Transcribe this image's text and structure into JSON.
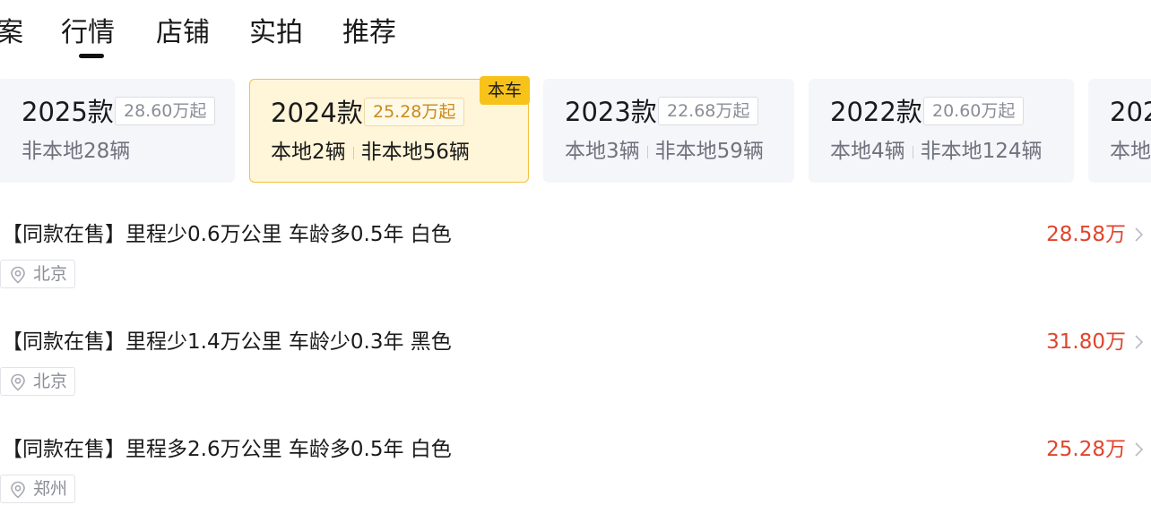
{
  "tabs": [
    {
      "label": "案"
    },
    {
      "label": "行情"
    },
    {
      "label": "店铺"
    },
    {
      "label": "实拍"
    },
    {
      "label": "推荐"
    }
  ],
  "active_tab": "行情",
  "year_cards": [
    {
      "year": "2025款",
      "price": "28.60万起",
      "stock": "非本地28辆"
    },
    {
      "year": "2024款",
      "price": "25.28万起",
      "local": "本地2辆",
      "nonlocal": "非本地56辆",
      "badge": "本车"
    },
    {
      "year": "2023款",
      "price": "22.68万起",
      "local": "本地3辆",
      "nonlocal": "非本地59辆"
    },
    {
      "year": "2022款",
      "price": "20.60万起",
      "local": "本地4辆",
      "nonlocal": "非本地124辆"
    },
    {
      "year": "202",
      "local": "本地"
    }
  ],
  "listings": [
    {
      "title": "【同款在售】里程少0.6万公里 车龄多0.5年 白色",
      "price": "28.58万",
      "city": "北京"
    },
    {
      "title": "【同款在售】里程少1.4万公里 车龄少0.3年 黑色",
      "price": "31.80万",
      "city": "北京"
    },
    {
      "title": "【同款在售】里程多2.6万公里 车龄多0.5年 白色",
      "price": "25.28万",
      "city": "郑州"
    }
  ],
  "colors": {
    "price_red": "#e0442b",
    "active_card_bg": "#fff5d9",
    "badge_yellow": "#f7c21a"
  },
  "icons": {
    "location": "location-pin-icon",
    "chevron": "chevron-right-icon"
  }
}
